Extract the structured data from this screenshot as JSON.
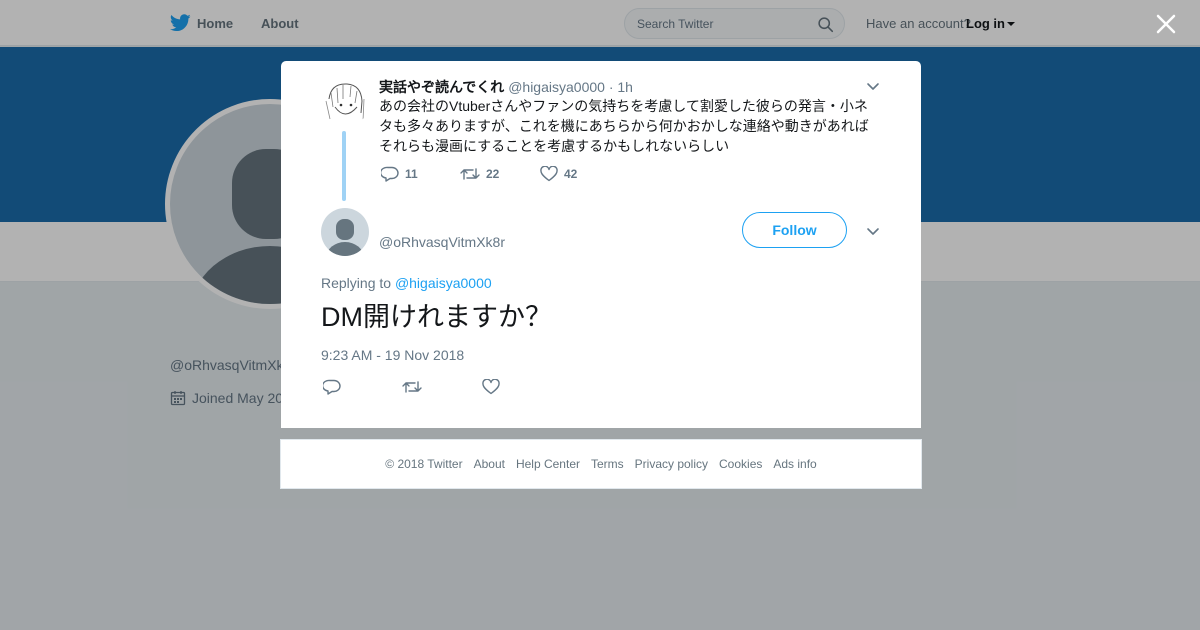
{
  "topbar": {
    "home_label": "Home",
    "about_label": "About",
    "search_placeholder": "Search Twitter",
    "account_prompt": "Have an account?",
    "login_label": "Log in"
  },
  "profile_bg": {
    "handle_partial": "@oRhvasqVitmXk",
    "joined_partial": "Joined May 20"
  },
  "parent_tweet": {
    "name": "実話やぞ読んでくれ",
    "handle": "@higaisya0000",
    "separator": "·",
    "time": "1h",
    "text": "あの会社のVtuberさんやファンの気持ちを考慮して割愛した彼らの発言・小ネタも多々ありますが、これを機にあちらから何かおかしな連絡や動きがあればそれらも漫画にすることを考慮するかもしれないらしい",
    "replies": "11",
    "retweets": "22",
    "likes": "42"
  },
  "main_tweet": {
    "handle": "@oRhvasqVitmXk8r",
    "follow_label": "Follow",
    "replying_prefix": "Replying to",
    "replying_handle": "@higaisya0000",
    "text": "DM開けれますか？",
    "timestamp": "9:23 AM - 19 Nov 2018"
  },
  "footer": {
    "copyright": "© 2018 Twitter",
    "links": [
      "About",
      "Help Center",
      "Terms",
      "Privacy policy",
      "Cookies",
      "Ads info"
    ]
  },
  "colors": {
    "brand_blue": "#1da1f2",
    "banner": "#1b6cab",
    "thread_line": "#9fd2f5",
    "text_primary": "#14171a",
    "text_secondary": "#657786"
  },
  "icons": [
    "twitter-bird-icon",
    "search-icon",
    "caret-down-icon",
    "close-icon",
    "reply-icon",
    "retweet-icon",
    "like-icon",
    "calendar-icon",
    "chevron-down-icon"
  ]
}
